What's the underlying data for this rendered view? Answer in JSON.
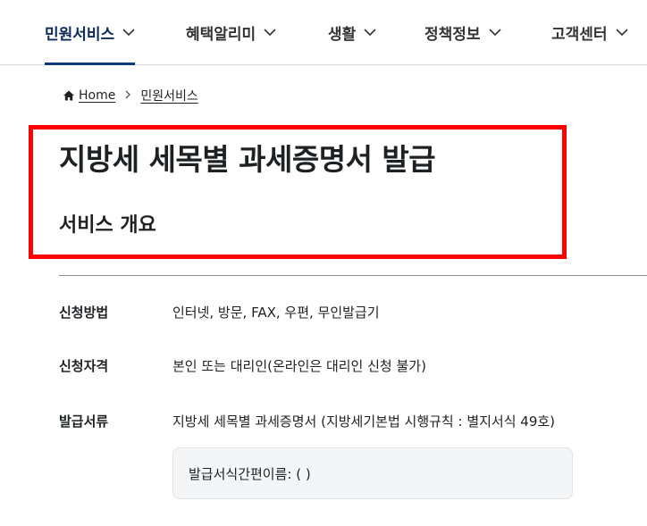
{
  "nav": {
    "items": [
      {
        "label": "민원서비스",
        "active": true
      },
      {
        "label": "혜택알리미",
        "active": false
      },
      {
        "label": "생활",
        "active": false
      },
      {
        "label": "정책정보",
        "active": false
      },
      {
        "label": "고객센터",
        "active": false
      }
    ]
  },
  "breadcrumb": {
    "home": "Home",
    "current": "민원서비스"
  },
  "page": {
    "title": "지방세 세목별 과세증명서 발급",
    "section_title": "서비스 개요"
  },
  "overview": {
    "rows": [
      {
        "label": "신청방법",
        "value": "인터넷, 방문, FAX, 우편, 무인발급기"
      },
      {
        "label": "신청자격",
        "value": "본인 또는 대리인(온라인은 대리인 신청 불가)"
      },
      {
        "label": "발급서류",
        "value": "지방세 세목별 과세증명서 (지방세기본법 시행규칙 : 별지서식 49호)"
      }
    ],
    "doc_note": "발급서식간편이름: ( )"
  },
  "colors": {
    "highlight_border": "#ff0000",
    "nav_active": "#0b3a7e"
  }
}
